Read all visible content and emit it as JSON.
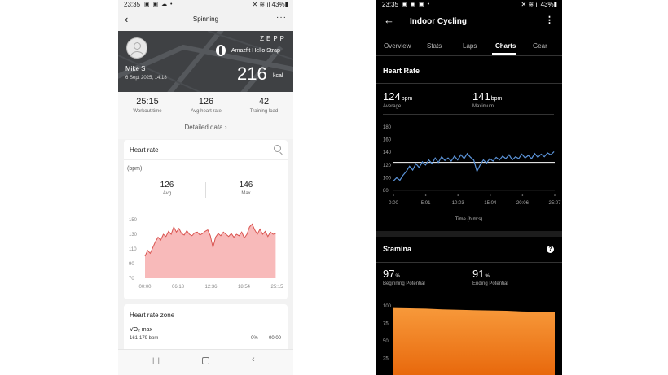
{
  "left_phone": {
    "status_bar": {
      "time": "23:35",
      "icons": "▣ ▣ ☁ •",
      "right": "✕ ≋ ıl 43%▮"
    },
    "header": {
      "title": "Spinning",
      "back_glyph": "‹",
      "more_glyph": "···"
    },
    "banner": {
      "brand": "ZEPP",
      "device": "Amazfit Helio Strap",
      "user": "Mike S",
      "date": "6 Sept 2025, 14:18",
      "calories": "216",
      "calories_unit": "kcal"
    },
    "stats": [
      {
        "value": "25:15",
        "label": "Workout time"
      },
      {
        "value": "126",
        "label": "Avg heart rate"
      },
      {
        "value": "42",
        "label": "Training load"
      }
    ],
    "detailed_link": "Detailed data",
    "detailed_chevron": "›",
    "heart_rate_card": {
      "title": "Heart rate",
      "unit": "(bpm)",
      "avg_value": "126",
      "avg_label": "Avg",
      "max_value": "146",
      "max_label": "Max"
    },
    "chart_data": {
      "type": "area",
      "y_ticks": [
        "150",
        "130",
        "110",
        "90",
        "70"
      ],
      "x_ticks": [
        "00:00",
        "06:18",
        "12:36",
        "18:54",
        "25:15"
      ],
      "ylim": [
        70,
        150
      ],
      "xlim_min": [
        0,
        25.25
      ],
      "x": [
        0,
        0.5,
        1,
        1.5,
        2,
        2.5,
        3,
        3.5,
        4,
        4.5,
        5,
        5.5,
        6,
        6.5,
        7,
        7.5,
        8,
        8.5,
        9,
        9.5,
        10,
        10.5,
        11,
        11.5,
        12,
        12.5,
        13,
        13.5,
        14,
        14.5,
        15,
        15.5,
        16,
        16.5,
        17,
        17.5,
        18,
        18.5,
        19,
        19.5,
        20,
        20.5,
        21,
        21.5,
        22,
        22.5,
        23,
        23.5,
        24,
        24.5,
        25
      ],
      "values": [
        100,
        108,
        104,
        112,
        120,
        126,
        122,
        130,
        127,
        134,
        130,
        140,
        133,
        138,
        131,
        129,
        135,
        130,
        128,
        132,
        133,
        129,
        131,
        134,
        136,
        128,
        112,
        126,
        131,
        128,
        133,
        130,
        127,
        131,
        126,
        130,
        128,
        133,
        125,
        130,
        140,
        144,
        136,
        130,
        137,
        130,
        134,
        127,
        133,
        130,
        131
      ],
      "fill": "#f5a3a3",
      "line": "#d9534f"
    },
    "zone_card": {
      "title": "Heart rate zone",
      "zone_name": "VO₂ max",
      "range": "161-179 bpm",
      "percent": "0%",
      "duration": "00:00"
    },
    "nav": {
      "recents": "|||",
      "back": "‹"
    }
  },
  "right_phone": {
    "status_bar": {
      "time": "23:35",
      "icons": "▣ ▣ ▣ •",
      "right": "✕ ≋ ıl 43%▮"
    },
    "header": {
      "title": "Indoor Cycling",
      "back_glyph": "←",
      "more_glyph": "⋮"
    },
    "tabs": [
      "Overview",
      "Stats",
      "Laps",
      "Charts",
      "Gear"
    ],
    "active_tab": "Charts",
    "heart_rate": {
      "title": "Heart Rate",
      "average_value": "124",
      "average_unit": "bpm",
      "average_label": "Average",
      "max_value": "141",
      "max_unit": "bpm",
      "max_label": "Maximum"
    },
    "hr_chart_data": {
      "type": "line",
      "y_ticks": [
        "180",
        "160",
        "140",
        "120",
        "100",
        "80"
      ],
      "x_ticks": [
        "0:00",
        "5:01",
        "10:03",
        "15:04",
        "20:06",
        "25:07"
      ],
      "xlabel": "Time (h:m:s)",
      "ylim": [
        80,
        180
      ],
      "xlim_min": [
        0,
        25.12
      ],
      "average_line": 124,
      "x": [
        0,
        0.5,
        1,
        1.5,
        2,
        2.5,
        3,
        3.5,
        4,
        4.5,
        5,
        5.5,
        6,
        6.5,
        7,
        7.5,
        8,
        8.5,
        9,
        9.5,
        10,
        10.5,
        11,
        11.5,
        12,
        12.5,
        13,
        13.5,
        14,
        14.5,
        15,
        15.5,
        16,
        16.5,
        17,
        17.5,
        18,
        18.5,
        19,
        19.5,
        20,
        20.5,
        21,
        21.5,
        22,
        22.5,
        23,
        23.5,
        24,
        24.5,
        25
      ],
      "values": [
        95,
        100,
        96,
        104,
        110,
        118,
        112,
        122,
        116,
        125,
        120,
        128,
        122,
        131,
        124,
        133,
        127,
        131,
        126,
        134,
        128,
        136,
        130,
        138,
        132,
        128,
        110,
        120,
        128,
        123,
        130,
        126,
        132,
        128,
        134,
        130,
        136,
        128,
        133,
        130,
        137,
        131,
        135,
        130,
        138,
        132,
        137,
        133,
        139,
        136,
        141
      ],
      "line": "#5b93d8"
    },
    "stamina": {
      "title": "Stamina",
      "help_glyph": "?",
      "begin_value": "97",
      "begin_unit": "%",
      "begin_label": "Beginning Potential",
      "end_value": "91",
      "end_unit": "%",
      "end_label": "Ending Potential"
    },
    "stamina_chart_data": {
      "type": "area",
      "y_ticks": [
        "100",
        "75",
        "50",
        "25"
      ],
      "ylim": [
        0,
        100
      ],
      "x": [
        0,
        0.1,
        0.2,
        0.3,
        0.4,
        0.5,
        0.6,
        0.7,
        0.8,
        0.9,
        1.0
      ],
      "values": [
        97,
        96.5,
        96,
        95,
        94.5,
        94,
        93.5,
        93,
        92,
        91.5,
        91
      ],
      "fill_top": "#f7993a",
      "fill_bottom": "#e8680c"
    }
  }
}
